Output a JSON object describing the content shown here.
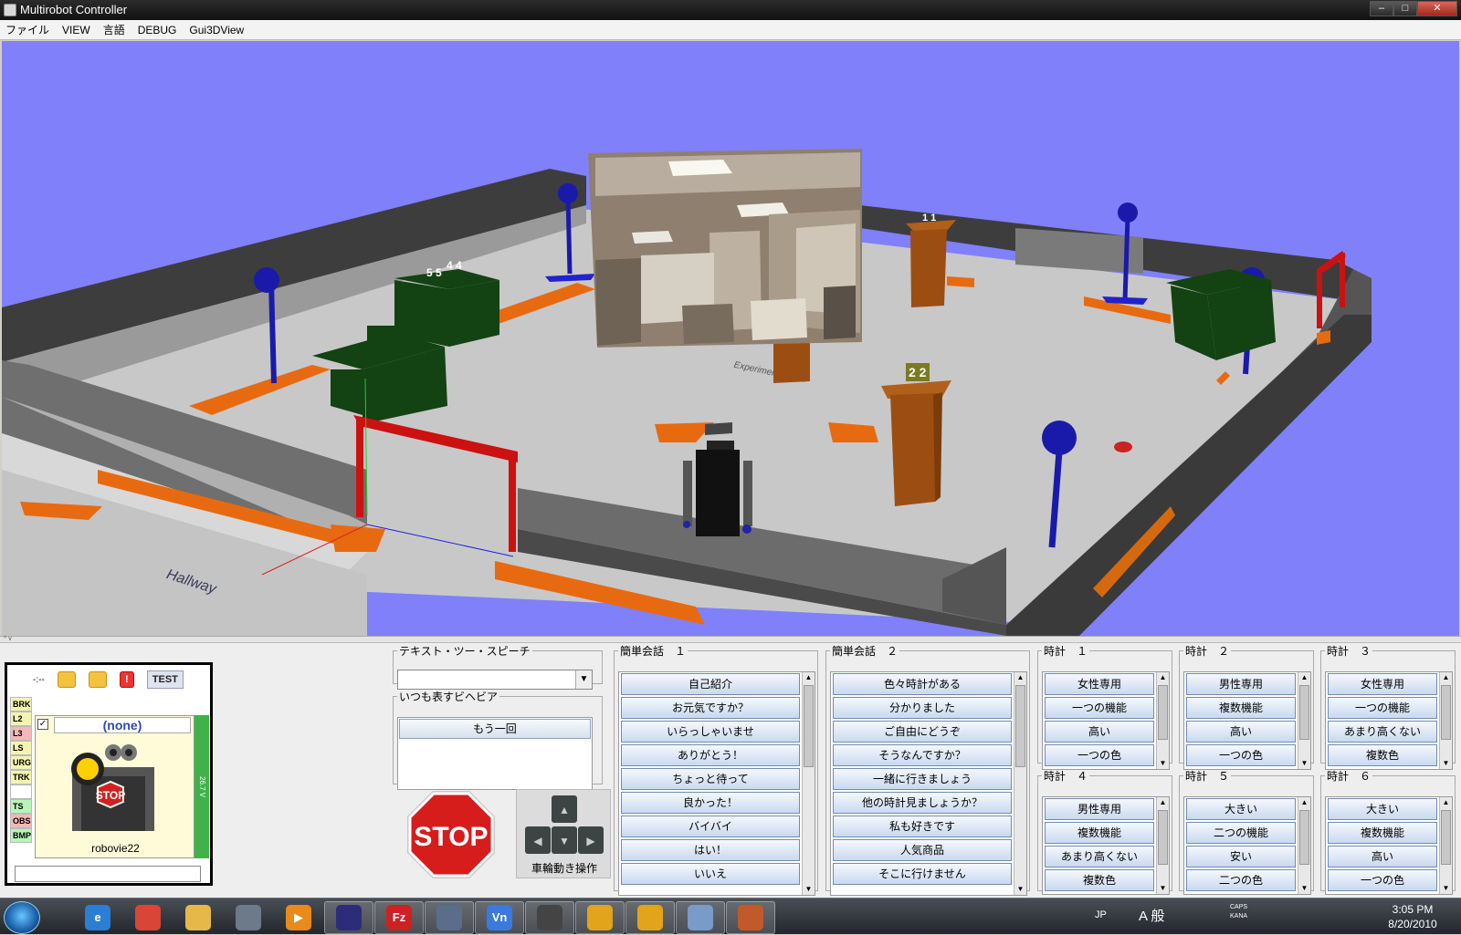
{
  "window": {
    "title": "Multirobot Controller"
  },
  "menu": [
    "ファイル",
    "VIEW",
    "言語",
    "DEBUG",
    "Gui3DView"
  ],
  "scene": {
    "labels": {
      "hallway": "Hallway",
      "experiment_room": "Experiment Room",
      "marker_55": "5 5",
      "marker_44": "4 4",
      "marker_11": "1 1",
      "marker_22": "2 2"
    },
    "colors": {
      "sky": "#8080fb",
      "floor": "#c8c8c8",
      "wall": "#4a4a4a",
      "pole": "#1a1aaa",
      "table": "#134213",
      "pillar": "#9c4e12",
      "gate": "#cc1111",
      "footprint": "#e86a10"
    }
  },
  "splitter": {
    "arrows": "^ v"
  },
  "robot_panel": {
    "toolbar_dash": "-:--",
    "toolbar_test": "TEST",
    "toolbar_alert": "!",
    "status_labels": [
      {
        "text": "BRK",
        "color": "#f4f4b0"
      },
      {
        "text": "L2",
        "color": "#f4f4b0"
      },
      {
        "text": "L3",
        "color": "#f4b8b8"
      },
      {
        "text": "LS",
        "color": "#f4f4b0"
      },
      {
        "text": "URG",
        "color": "#f4f4b0"
      },
      {
        "text": "TRK",
        "color": "#f4f4b0"
      },
      {
        "text": "",
        "color": "#ffffff"
      },
      {
        "text": "TS",
        "color": "#b8f4b8"
      },
      {
        "text": "OBS",
        "color": "#f4b8b8"
      },
      {
        "text": "BMP",
        "color": "#b8f4b8"
      }
    ],
    "robot_selector": "(none)",
    "robot_name": "robovie22",
    "stop_sign": "STOP",
    "voltage": "26.7 V",
    "text_input_value": ""
  },
  "tts": {
    "legend": "テキスト・ツー・スピーチ",
    "value": ""
  },
  "always": {
    "legend": "いつも表すビヘビア",
    "items": [
      "もう一回"
    ]
  },
  "stop_button": "STOP",
  "wheel": {
    "label": "車輪動き操作"
  },
  "groups": {
    "simple1": {
      "legend": "簡単会話　１",
      "items": [
        "自己紹介",
        "お元気ですか？",
        "いらっしゃいませ",
        "ありがとう！",
        "ちょっと待って",
        "良かった！",
        "バイバイ",
        "はい！",
        "いいえ"
      ]
    },
    "simple2": {
      "legend": "簡単会話　２",
      "items": [
        "色々時計がある",
        "分かりました",
        "ご自由にどうぞ",
        "そうなんですか？",
        "一緒に行きましょう",
        "他の時計見ましょうか？",
        "私も好きです",
        "人気商品",
        "そこに行けません"
      ]
    },
    "clock1": {
      "legend": "時計　１",
      "items": [
        "女性専用",
        "一つの機能",
        "高い",
        "一つの色"
      ]
    },
    "clock2": {
      "legend": "時計　２",
      "items": [
        "男性専用",
        "複数機能",
        "高い",
        "一つの色"
      ]
    },
    "clock3": {
      "legend": "時計　３",
      "items": [
        "女性専用",
        "一つの機能",
        "あまり高くない",
        "複数色"
      ]
    },
    "clock4": {
      "legend": "時計　４",
      "items": [
        "男性専用",
        "複数機能",
        "あまり高くない",
        "複数色"
      ]
    },
    "clock5": {
      "legend": "時計　５",
      "items": [
        "大きい",
        "二つの機能",
        "安い",
        "二つの色"
      ]
    },
    "clock6": {
      "legend": "時計　６",
      "items": [
        "大きい",
        "複数機能",
        "高い",
        "一つの色"
      ]
    }
  },
  "taskbar": {
    "apps": [
      {
        "name": "internet-explorer-icon",
        "glyph": "e",
        "color": "#2a7fd4"
      },
      {
        "name": "chrome-icon",
        "glyph": "",
        "color": "#d94536"
      },
      {
        "name": "explorer-folder-icon",
        "glyph": "",
        "color": "#e6b84a"
      },
      {
        "name": "pen-tool-icon",
        "glyph": "",
        "color": "#6c7a8a"
      },
      {
        "name": "media-player-icon",
        "glyph": "▶",
        "color": "#e88a1c"
      },
      {
        "name": "eclipse-icon",
        "glyph": "",
        "color": "#2c2c7a"
      },
      {
        "name": "filezilla-icon",
        "glyph": "Fz",
        "color": "#c22"
      },
      {
        "name": "network-icon",
        "glyph": "",
        "color": "#5a6e8a"
      },
      {
        "name": "vnc-icon",
        "glyph": "Vn",
        "color": "#3a7adf"
      },
      {
        "name": "inkscape-icon",
        "glyph": "",
        "color": "#444"
      },
      {
        "name": "robot-app-icon",
        "glyph": "",
        "color": "#e2a41a"
      },
      {
        "name": "robot-app-2-icon",
        "glyph": "",
        "color": "#e2a41a"
      },
      {
        "name": "paint-icon",
        "glyph": "",
        "color": "#7a9ac8"
      },
      {
        "name": "java-icon",
        "glyph": "",
        "color": "#c05a2a"
      }
    ],
    "ime_lang": "JP",
    "ime_mode": "A 般",
    "caps": "CAPS",
    "kana": "KANA",
    "time": "3:05 PM",
    "date": "8/20/2010"
  }
}
